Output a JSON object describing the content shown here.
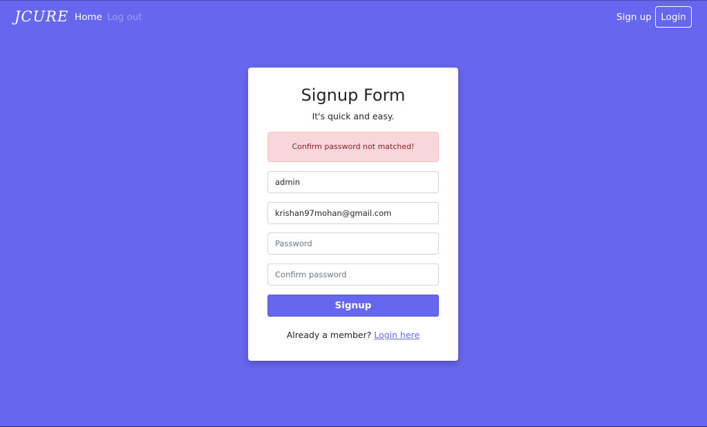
{
  "navbar": {
    "brand": "JCURE",
    "links": {
      "home": "Home",
      "logout": "Log out",
      "signup": "Sign up",
      "login": "Login"
    }
  },
  "form": {
    "title": "Signup Form",
    "subtitle": "It's quick and easy.",
    "alert": "Confirm password not matched!",
    "fields": {
      "username": {
        "value": "admin",
        "placeholder": ""
      },
      "email": {
        "value": "krishan97mohan@gmail.com",
        "placeholder": ""
      },
      "password": {
        "value": "",
        "placeholder": "Password"
      },
      "confirm_password": {
        "value": "",
        "placeholder": "Confirm password"
      }
    },
    "submit_label": "Signup",
    "footer": {
      "prompt": "Already a member?",
      "link": "Login here"
    }
  },
  "colors": {
    "background": "#6766ee",
    "accent": "#6766ee",
    "alert_bg": "#f8d7da",
    "alert_text": "#842029",
    "inactive_link": "#9e9ef3"
  }
}
